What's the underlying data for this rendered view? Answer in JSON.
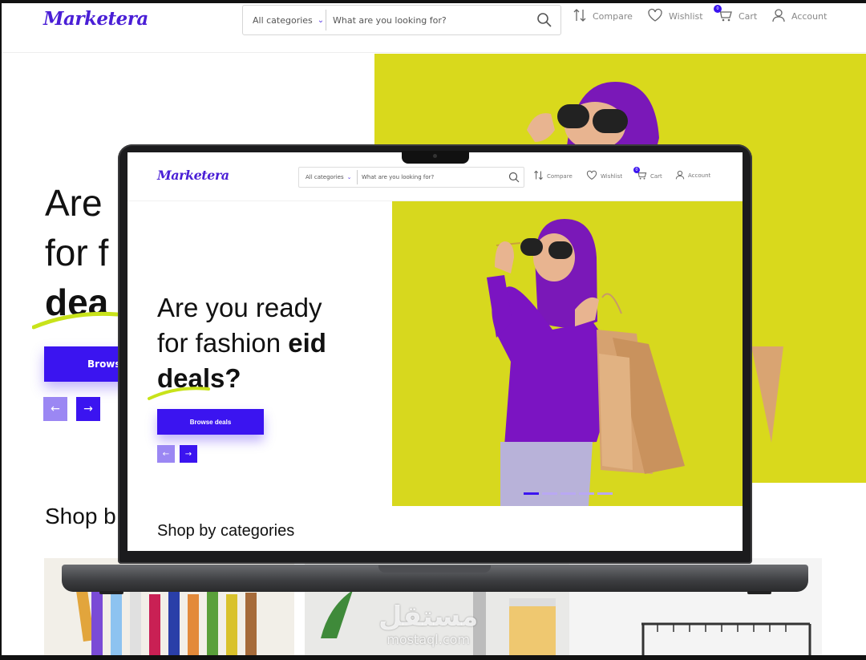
{
  "brand": {
    "logo": "Marketera",
    "accent": "#3b14f0",
    "hero_bg": "#d7d81e"
  },
  "header": {
    "category_select": "All categories",
    "search_placeholder": "What are you looking for?",
    "nav": {
      "compare": "Compare",
      "wishlist": "Wishlist",
      "cart": "Cart",
      "account": "Account"
    },
    "cart_count": "0"
  },
  "hero": {
    "line1": "Are you ready",
    "line2_prefix": "for fashion ",
    "line2_bold": "eid",
    "line3": "deals?",
    "button": "Browse deals",
    "prev_icon": "←",
    "next_icon": "→",
    "slides_total": 5,
    "slide_active": 1
  },
  "bg_partial": {
    "l1": "Are",
    "l2": "for f",
    "l3": "dea",
    "button": "Brows",
    "shop": "Shop b"
  },
  "categories": {
    "heading": "Shop by categories"
  },
  "watermark": {
    "arabic": "مستقل",
    "latin": "mostaql.com"
  }
}
